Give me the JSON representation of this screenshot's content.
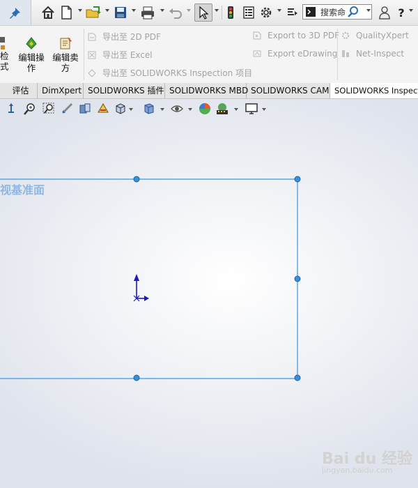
{
  "toolbar": {
    "search_label": "搜索命",
    "help_label": "?"
  },
  "ribbon": {
    "big_buttons": [
      {
        "label_line1": "检",
        "label_line2": "式"
      },
      {
        "label_line1": "编辑操",
        "label_line2": "作"
      },
      {
        "label_line1": "编辑卖",
        "label_line2": "方"
      }
    ],
    "export_items": [
      "导出至 2D PDF",
      "导出至 Excel",
      "导出至 SOLIDWORKS Inspection 项目",
      "Export to 3D PDF",
      "Export eDrawing",
      "QualityXpert",
      "Net-Inspect"
    ]
  },
  "tabs": [
    "评估",
    "DimXpert",
    "SOLIDWORKS 插件",
    "SOLIDWORKS MBD",
    "SOLIDWORKS CAM",
    "SOLIDWORKS Inspection"
  ],
  "viewport": {
    "plane_label": "视基准面"
  },
  "watermark": {
    "text": "Bai du 经验",
    "sub": "jingyan.baidu.com"
  },
  "colors": {
    "plane_edge": "#5aa6e6",
    "plane_handle": "#3a8fd6",
    "origin": "#1b1bb5",
    "ribbon_bg": "#f4f4f4"
  }
}
